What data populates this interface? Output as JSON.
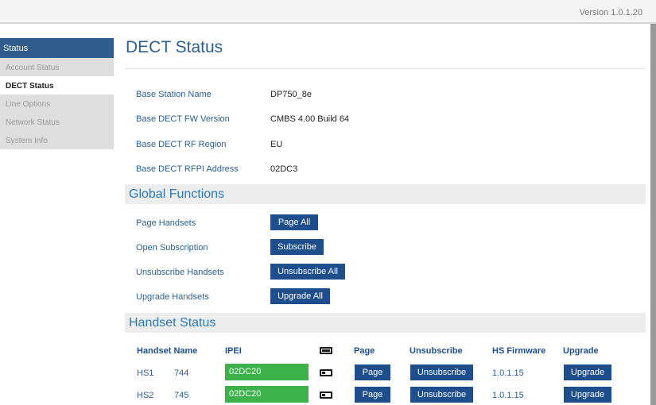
{
  "header": {
    "version": "Version 1.0.1.20"
  },
  "sidebar": {
    "header": "Status",
    "items": [
      {
        "label": "Account Status"
      },
      {
        "label": "DECT Status"
      },
      {
        "label": "Line Options"
      },
      {
        "label": "Network Status"
      },
      {
        "label": "System Info"
      }
    ]
  },
  "page": {
    "title": "DECT Status"
  },
  "base_info": [
    {
      "label": "Base Station Name",
      "value": "DP750_8e"
    },
    {
      "label": "Base DECT FW Version",
      "value": "CMBS 4.00 Build 64"
    },
    {
      "label": "Base DECT RF Region",
      "value": "EU"
    },
    {
      "label": "Base DECT RFPI Address",
      "value": "02DC3"
    }
  ],
  "global_functions": {
    "title": "Global Functions",
    "rows": [
      {
        "label": "Page Handsets",
        "button": "Page All"
      },
      {
        "label": "Open Subscription",
        "button": "Subscribe"
      },
      {
        "label": "Unsubscribe Handsets",
        "button": "Unsubscribe All"
      },
      {
        "label": "Upgrade Handsets",
        "button": "Upgrade All"
      }
    ]
  },
  "handset_status": {
    "title": "Handset Status",
    "columns": {
      "handset_name": "Handset Name",
      "ipei": "IPEI",
      "battery_icon": "battery-icon",
      "page": "Page",
      "unsubscribe": "Unsubscribe",
      "hs_firmware": "HS Firmware",
      "upgrade": "Upgrade"
    },
    "rows": [
      {
        "handset": "HS1",
        "name": "744",
        "ipei": "02DC20",
        "battery_icon": "battery-low-icon",
        "page": "Page",
        "unsubscribe": "Unsubscribe",
        "firmware": "1.0.1.15",
        "upgrade": "Upgrade"
      },
      {
        "handset": "HS2",
        "name": "745",
        "ipei": "02DC20",
        "battery_icon": "battery-low-icon",
        "page": "Page",
        "unsubscribe": "Unsubscribe",
        "firmware": "1.0.1.15",
        "upgrade": "Upgrade"
      }
    ]
  },
  "colors": {
    "accent": "#1f4e8c",
    "title": "#2a5f8f",
    "section_title": "#2a7ab8",
    "status_ok": "#3db24a",
    "sidebar_header": "#2f5e8c"
  }
}
